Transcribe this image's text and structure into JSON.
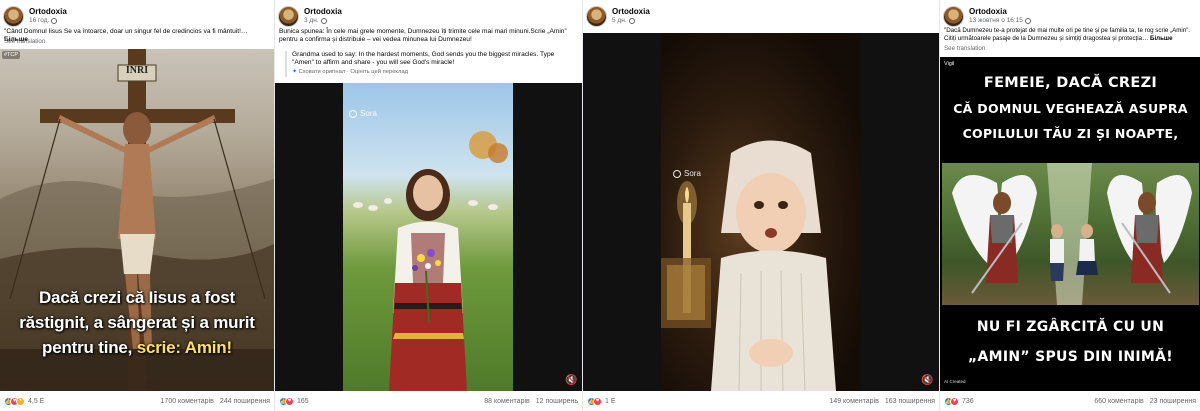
{
  "posts": [
    {
      "page_name": "Ortodoxia",
      "time": "16 год.",
      "caption": "\"Când Domnul Iisus Se va întoarce, doar un singur fel de credincios va fi mântuit!…",
      "more": "Більше",
      "see_translation": "See translation",
      "overlay_lines": [
        "Dacă crezi că Iisus a fost",
        "răstignit, a sângerat și a murit",
        "pentru tine, "
      ],
      "overlay_highlight": "scrie: Amin!",
      "tag": "#TCP",
      "inri": "INRI",
      "reactions_count": "4,5 Е",
      "comments": "1700 коментарів",
      "shares": "244 поширення"
    },
    {
      "page_name": "Ortodoxia",
      "time": "3 дн.",
      "caption": "Bunica spunea: În cele mai grele momente, Dumnezeu îți trimite cele mai mari minuni.Scrie „Amin” pentru a confirma și distribuie – vei vedea minunea lui Dumnezeu!",
      "translation": "Grandma used to say: In the hardest moments, God sends you the biggest miracles. Type \"Amen\" to affirm and share - you will see God's miracle!",
      "hide_original": "Сховати оригінал",
      "rate_translation": "Оцініть цей переклад",
      "sora": "Sora",
      "reactions_count": "165",
      "comments": "88 коментарів",
      "shares": "12 поширень"
    },
    {
      "page_name": "Ortodoxia",
      "time": "5 дн.",
      "sora": "Sora",
      "reactions_count": "1 Е",
      "comments": "149 коментарів",
      "shares": "163 поширення"
    },
    {
      "page_name": "Ortodoxia",
      "time": "13 жовтня о 16:15",
      "caption": "\"Dacă Dumnezeu te-a protejat de mai multe ori pe tine și pe familia ta, te rog scrie „Amin”. Citiți următoarele pasaje de la Dumnezeu și simțiți dragostea și protecția…",
      "more": "Більше",
      "see_translation": "See translation",
      "top_lines": [
        "FEMEIE, DACĂ CREZI",
        "CĂ DOMNUL VEGHEAZĂ ASUPRA",
        "COPILULUI TĂU ZI ȘI NOAPTE,"
      ],
      "bottom_lines": [
        "NU FI ZGÂRCITĂ CU UN",
        "„AMIN” SPUS DIN INIMĂ!"
      ],
      "tag": "Vigil",
      "ai_label": "AI Created",
      "reactions_count": "736",
      "comments": "660 коментарів",
      "shares": "23 поширення"
    }
  ]
}
